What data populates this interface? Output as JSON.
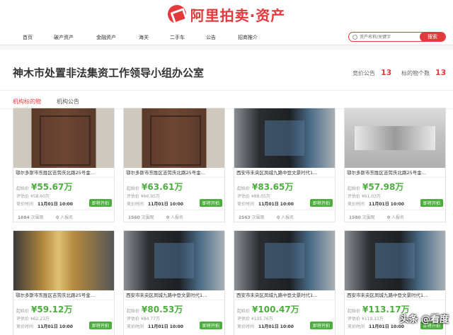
{
  "brand": {
    "logo_text": "阿里拍卖·资产"
  },
  "nav": {
    "items": [
      "首页",
      "破产资产",
      "金融资产",
      "海关",
      "二手车",
      "公告",
      "招商推介"
    ],
    "search_placeholder": "资产名称/关键字",
    "search_button": "搜索"
  },
  "org": {
    "title": "神木市处置非法集资工作领导小组办公室",
    "stats": [
      {
        "label": "竞价公告",
        "value": "13"
      },
      {
        "label": "标的物个数",
        "value": "13"
      }
    ]
  },
  "tabs": [
    "机构标的物",
    "机构公告"
  ],
  "labels": {
    "start_price": "起始价",
    "eval_price": "评估价",
    "auction_time": "竞价时间",
    "upcoming": "即将开拍",
    "views": "次围观",
    "signups": "人报名"
  },
  "lots": [
    {
      "photo": "door",
      "addr": "鄂尔多斯市东胜区吉劳庆北路25号金...",
      "price": "¥55.67万",
      "eval": "¥58.60万",
      "time": "11月01日 10:00",
      "views": "1684",
      "signups": "0"
    },
    {
      "photo": "door",
      "addr": "鄂尔多斯市东胜区吉劳庆北路25号金...",
      "price": "¥63.61万",
      "eval": "¥66.95万",
      "time": "11月01日 10:00",
      "views": "1560",
      "signups": "0"
    },
    {
      "photo": "dark",
      "addr": "西安市未央区凤城九路中登文景时代1...",
      "price": "¥83.65万",
      "eval": "¥88.05万",
      "time": "11月01日 10:00",
      "views": "2563",
      "signups": "0"
    },
    {
      "photo": "room",
      "addr": "鄂尔多斯市东胜区吉劳庆北路25号金...",
      "price": "¥57.98万",
      "eval": "¥61.03万",
      "time": "11月01日 10:00",
      "views": "1580",
      "signups": "0"
    },
    {
      "photo": "plaque",
      "addr": "鄂尔多斯市东胜区吉劳庆北路25号金...",
      "price": "¥59.12万",
      "eval": "¥62.23万",
      "time": "11月01日 10:00",
      "views": "",
      "signups": ""
    },
    {
      "photo": "dark",
      "addr": "西安市未央区凤城九路中登文景时代1...",
      "price": "¥80.53万",
      "eval": "¥84.77万",
      "time": "11月01日 10:00",
      "views": "",
      "signups": ""
    },
    {
      "photo": "dark",
      "addr": "西安市未央区凤城九路中登文景时代1...",
      "price": "¥100.47万",
      "eval": "¥105.76万",
      "time": "11月01日 10:00",
      "views": "",
      "signups": ""
    },
    {
      "photo": "dark",
      "addr": "西安市未央区凤城九路中登文景时代1...",
      "price": "¥113.17万",
      "eval": "¥119.13万",
      "time": "11月01日 10:00",
      "views": "",
      "signups": ""
    }
  ],
  "watermark": "头条 @看度"
}
